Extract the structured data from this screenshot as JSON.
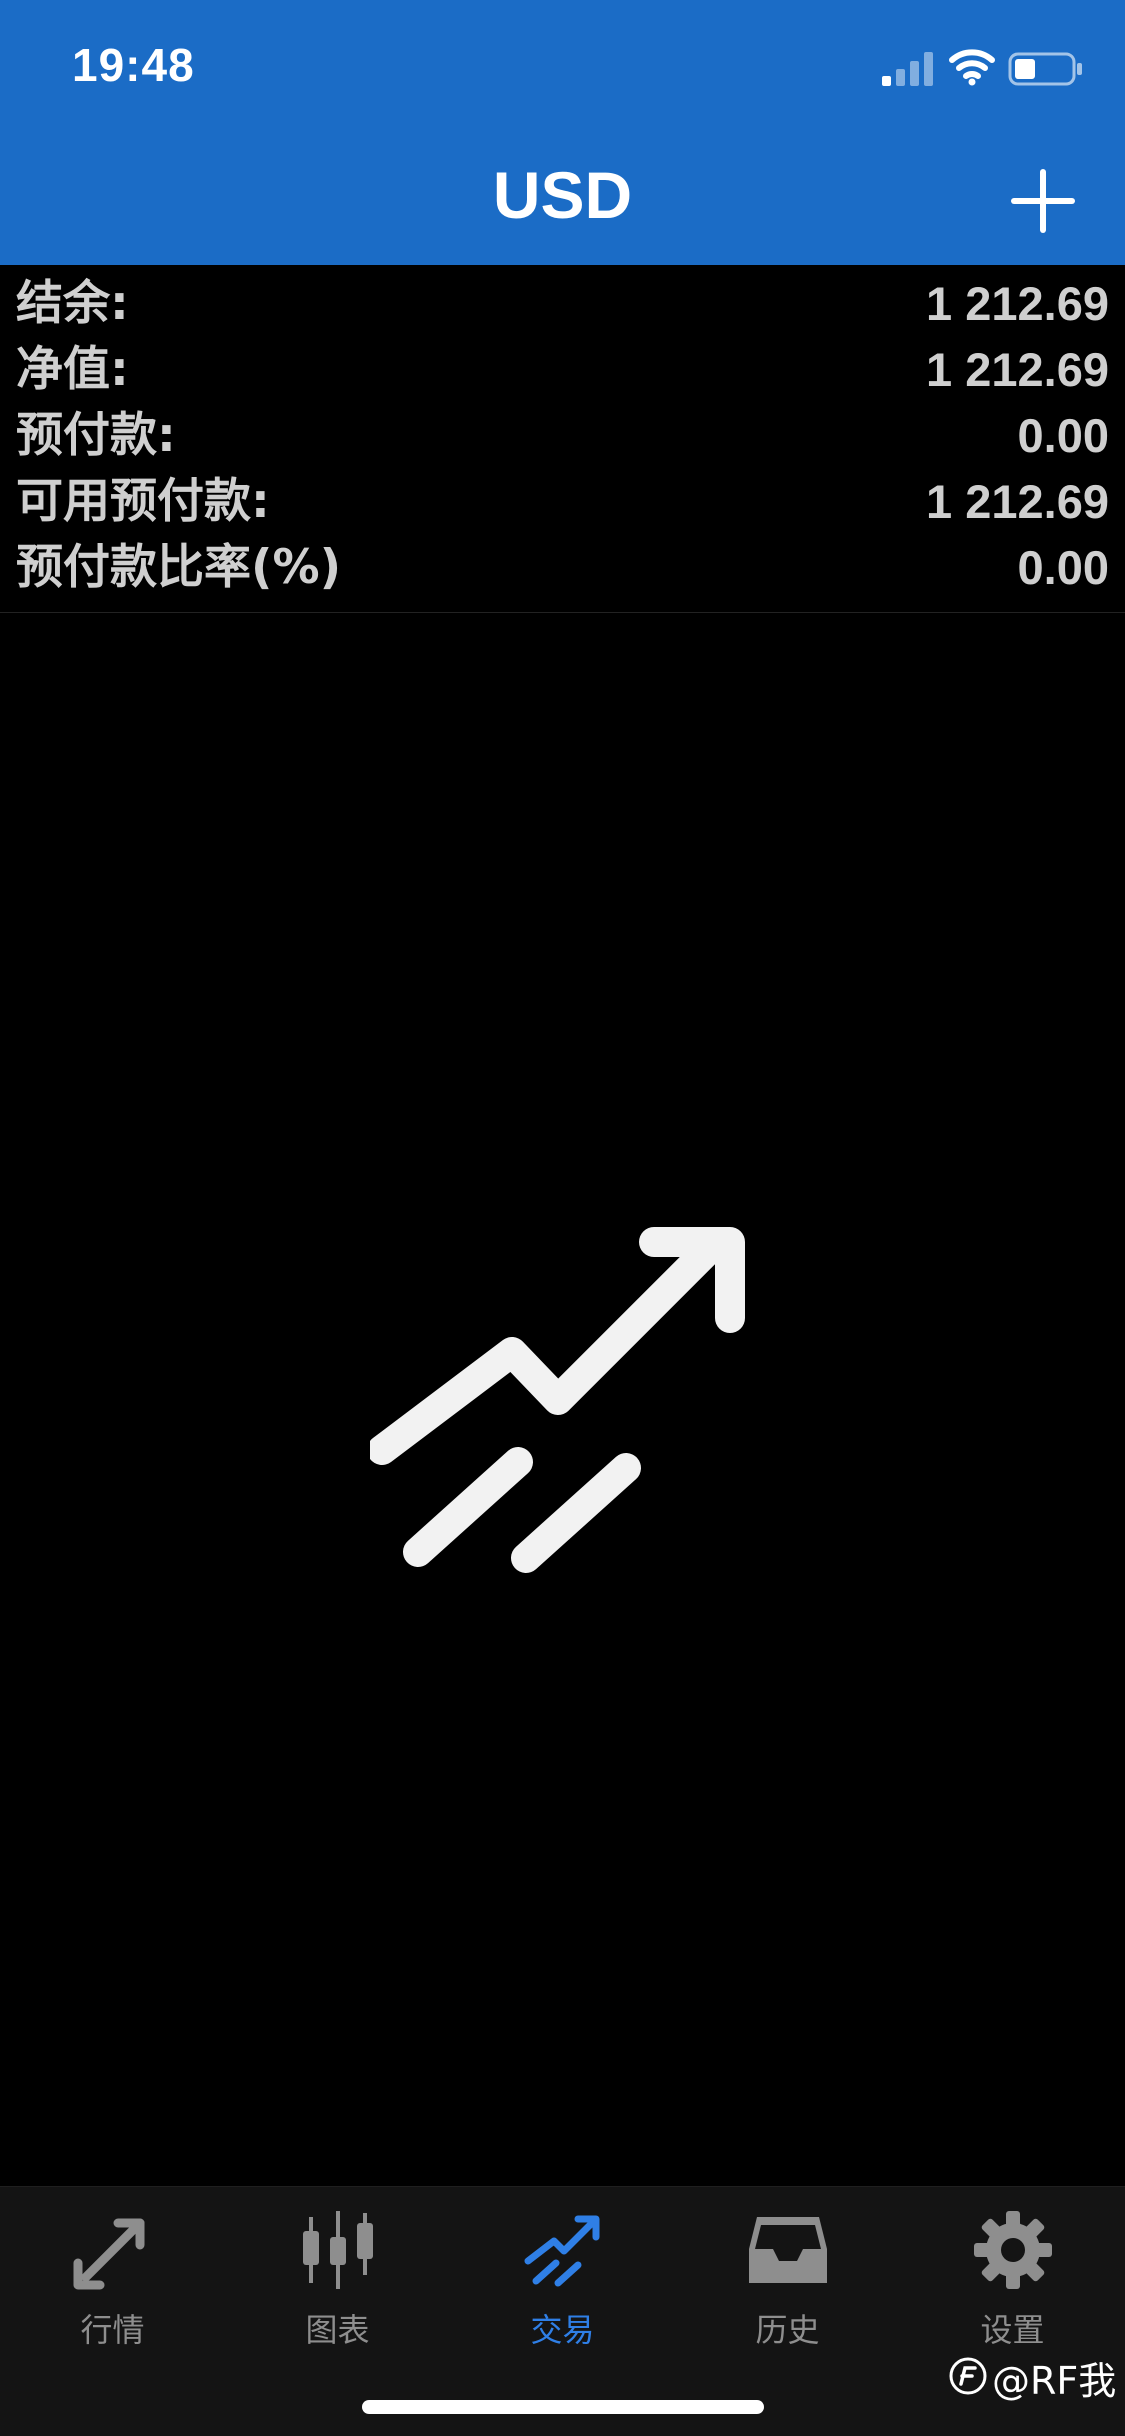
{
  "status_bar": {
    "time": "19:48"
  },
  "nav": {
    "title": "USD"
  },
  "summary": [
    {
      "label": "结余:",
      "value": "1 212.69"
    },
    {
      "label": "净值:",
      "value": "1 212.69"
    },
    {
      "label": "预付款:",
      "value": "0.00"
    },
    {
      "label": "可用预付款:",
      "value": "1 212.69"
    },
    {
      "label": "预付款比率(%)",
      "value": "0.00"
    }
  ],
  "tabs": [
    {
      "label": "行情",
      "icon": "quotes-arrows-icon",
      "active": false
    },
    {
      "label": "图表",
      "icon": "candlestick-chart-icon",
      "active": false
    },
    {
      "label": "交易",
      "icon": "trade-trend-icon",
      "active": true
    },
    {
      "label": "历史",
      "icon": "inbox-history-icon",
      "active": false
    },
    {
      "label": "设置",
      "icon": "gear-icon",
      "active": false
    }
  ],
  "colors": {
    "header_bg": "#1b6cc6",
    "active_tab": "#2f7fe6",
    "inactive_tab": "#8e8e8e",
    "text": "#cfcfcf"
  },
  "watermark": {
    "text": "@RF我"
  }
}
